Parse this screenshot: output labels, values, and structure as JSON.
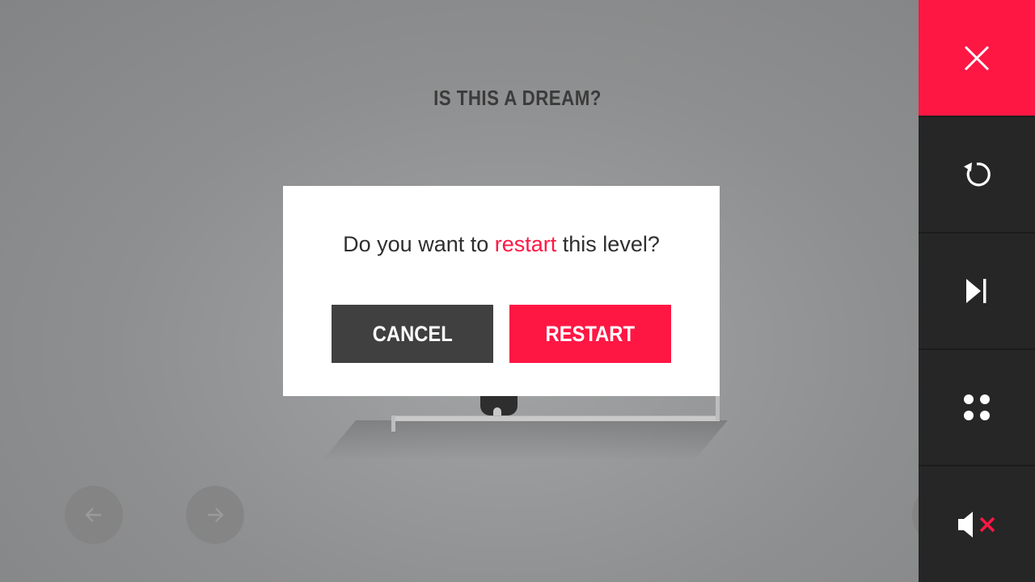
{
  "level": {
    "title": "IS THIS A DREAM?"
  },
  "dialog": {
    "question_prefix": "Do you want to ",
    "question_highlight": "restart",
    "question_suffix": " this level?",
    "cancel_label": "CANCEL",
    "restart_label": "RESTART"
  },
  "sidebar": {
    "items": [
      {
        "icon": "close-icon"
      },
      {
        "icon": "restart-icon"
      },
      {
        "icon": "skip-level-icon"
      },
      {
        "icon": "level-select-icon"
      },
      {
        "icon": "sound-muted-icon"
      }
    ]
  },
  "navigation": {
    "previous_icon": "arrow-left-icon",
    "next_icon": "arrow-right-icon"
  },
  "colors": {
    "accent": "#ff1744",
    "dark_button": "#404040",
    "sidebar": "#262626",
    "background": "#959697"
  }
}
